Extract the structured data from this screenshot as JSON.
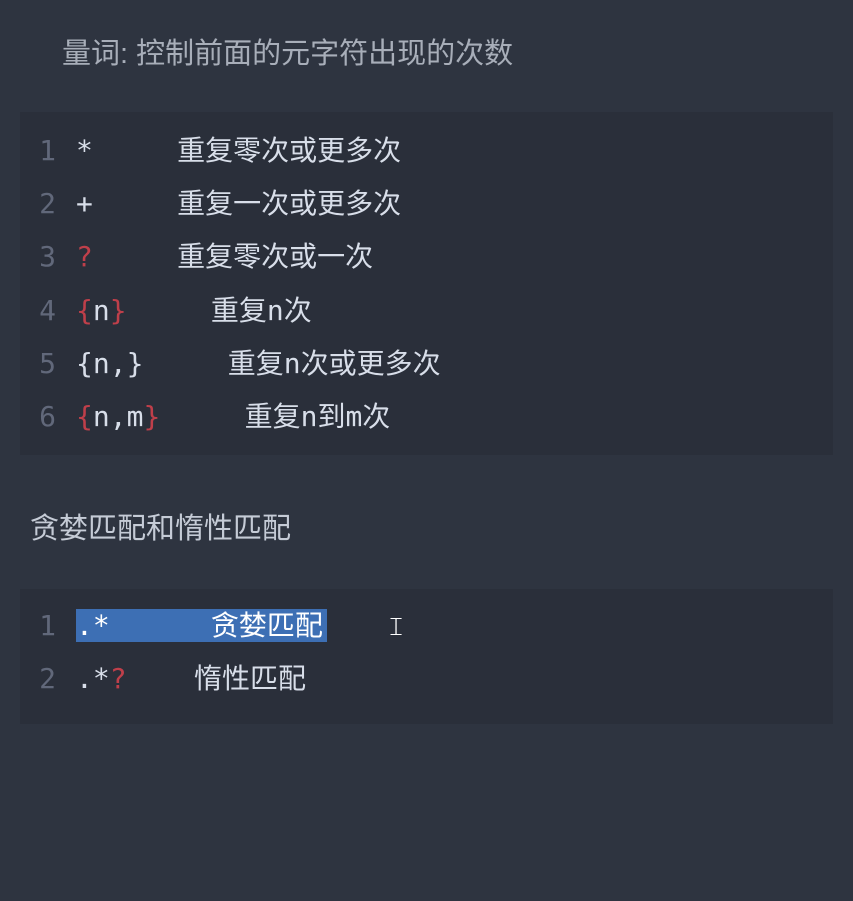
{
  "heading1": "量词: 控制前面的元字符出现的次数",
  "block1": {
    "lines": [
      {
        "num": "1",
        "symbol_plain": "*",
        "symbol_red": "",
        "desc": "     重复零次或更多次"
      },
      {
        "num": "2",
        "symbol_plain": "+",
        "symbol_red": "",
        "desc": "     重复一次或更多次"
      },
      {
        "num": "3",
        "symbol_plain": "",
        "symbol_red": "?",
        "desc": "     重复零次或一次"
      },
      {
        "num": "4",
        "symbol_plain": "",
        "symbol_red": "{",
        "symbol_mid": "n",
        "symbol_red2": "}",
        "desc": "     重复n次"
      },
      {
        "num": "5",
        "symbol_plain": "{n,}",
        "symbol_red": "",
        "desc": "     重复n次或更多次"
      },
      {
        "num": "6",
        "symbol_plain": "",
        "symbol_red": "{",
        "symbol_mid": "n,m",
        "symbol_red2": "}",
        "desc": "     重复n到m次"
      }
    ]
  },
  "heading2": "贪婪匹配和惰性匹配",
  "block2": {
    "line1": {
      "num": "1",
      "sel_text": ".*      贪婪匹配",
      "cursor": "𝙸"
    },
    "line2": {
      "num": "2",
      "prefix": ".*",
      "red": "?",
      "desc": "    惰性匹配"
    }
  }
}
